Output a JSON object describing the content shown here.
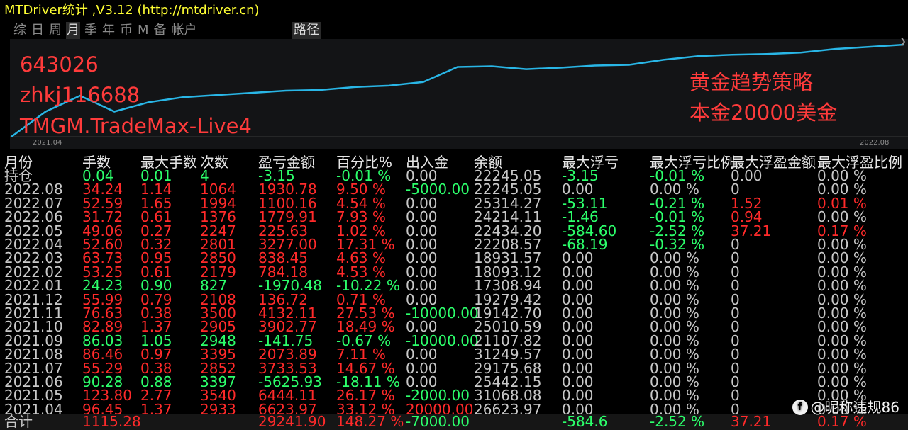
{
  "window": {
    "title": "MTDriver统计 ,V3.12 (http://mtdriver.cn)"
  },
  "tabs": [
    {
      "label": "综"
    },
    {
      "label": "日"
    },
    {
      "label": "周"
    },
    {
      "label": "月",
      "active": true
    },
    {
      "label": "季"
    },
    {
      "label": "年"
    },
    {
      "label": "币"
    },
    {
      "label": "M"
    },
    {
      "label": "备"
    },
    {
      "label": "帐户"
    }
  ],
  "path_button": "路径",
  "chart_data": {
    "type": "line",
    "x_start_label": "2021.04",
    "x_end_label": "2022.08",
    "series": [
      {
        "values": [
          0.0,
          0.35,
          0.57,
          0.35,
          0.48,
          0.55,
          0.58,
          0.61,
          0.64,
          0.65,
          0.69,
          0.71,
          0.76,
          0.97,
          0.98,
          0.94,
          0.96,
          0.99,
          1.0,
          1.07,
          1.12,
          1.14,
          1.15,
          1.17,
          1.22,
          1.25,
          1.28
        ]
      }
    ],
    "line_color": "#29b6e6",
    "annotations_left": [
      "643026",
      "zhkj116688",
      "TMGM.TradeMax-Live4"
    ],
    "annotations_right": [
      "黄金趋势策略",
      "本金20000美金"
    ]
  },
  "table": {
    "headers": [
      "月份",
      "手数",
      "最大手数",
      "次数",
      "盈亏金额",
      "百分比%",
      "出入金",
      "余额",
      "最大浮亏",
      "最大浮亏比例",
      "最大浮盈金额",
      "最大浮盈比例"
    ],
    "rows": [
      {
        "month": "持仓",
        "lots": "0.04",
        "max_lots": "0.01",
        "count": "4",
        "pnl": "-3.15",
        "pct": "-0.01 %",
        "inout": "0.00",
        "balance": "22245.05",
        "max_float_loss": "-3.15",
        "max_float_loss_pct": "-0.01 %",
        "max_float_profit": "0.00",
        "max_float_profit_pct": "0.00 %",
        "sign": "green"
      },
      {
        "month": "2022.08",
        "lots": "34.24",
        "max_lots": "1.14",
        "count": "1064",
        "pnl": "1930.78",
        "pct": "9.50 %",
        "inout": "-5000.00",
        "balance": "22245.05",
        "max_float_loss": "0.00",
        "max_float_loss_pct": "0.00 %",
        "max_float_profit": "0",
        "max_float_profit_pct": "0.00 %",
        "sign": "red"
      },
      {
        "month": "2022.07",
        "lots": "52.59",
        "max_lots": "1.65",
        "count": "1994",
        "pnl": "1100.16",
        "pct": "4.54 %",
        "inout": "0.00",
        "balance": "25314.27",
        "max_float_loss": "-53.11",
        "max_float_loss_pct": "-0.21 %",
        "max_float_profit": "1.52",
        "max_float_profit_pct": "0.01 %",
        "sign": "red"
      },
      {
        "month": "2022.06",
        "lots": "31.72",
        "max_lots": "0.61",
        "count": "1376",
        "pnl": "1779.91",
        "pct": "7.93 %",
        "inout": "0.00",
        "balance": "24214.11",
        "max_float_loss": "-1.46",
        "max_float_loss_pct": "-0.01 %",
        "max_float_profit": "0.94",
        "max_float_profit_pct": "0.00 %",
        "sign": "red"
      },
      {
        "month": "2022.05",
        "lots": "49.06",
        "max_lots": "0.27",
        "count": "2247",
        "pnl": "225.63",
        "pct": "1.02 %",
        "inout": "0.00",
        "balance": "22434.20",
        "max_float_loss": "-584.60",
        "max_float_loss_pct": "-2.52 %",
        "max_float_profit": "37.21",
        "max_float_profit_pct": "0.17 %",
        "sign": "red"
      },
      {
        "month": "2022.04",
        "lots": "52.60",
        "max_lots": "0.32",
        "count": "2801",
        "pnl": "3277.00",
        "pct": "17.31 %",
        "inout": "0.00",
        "balance": "22208.57",
        "max_float_loss": "-68.19",
        "max_float_loss_pct": "-0.32 %",
        "max_float_profit": "0",
        "max_float_profit_pct": "0.00 %",
        "sign": "red"
      },
      {
        "month": "2022.03",
        "lots": "63.73",
        "max_lots": "0.95",
        "count": "2850",
        "pnl": "838.45",
        "pct": "4.63 %",
        "inout": "0.00",
        "balance": "18931.57",
        "max_float_loss": "0.00",
        "max_float_loss_pct": "0.00 %",
        "max_float_profit": "0",
        "max_float_profit_pct": "0.00 %",
        "sign": "red"
      },
      {
        "month": "2022.02",
        "lots": "53.25",
        "max_lots": "0.61",
        "count": "2179",
        "pnl": "784.18",
        "pct": "4.53 %",
        "inout": "0.00",
        "balance": "18093.12",
        "max_float_loss": "0.00",
        "max_float_loss_pct": "0.00 %",
        "max_float_profit": "0",
        "max_float_profit_pct": "0.00 %",
        "sign": "red"
      },
      {
        "month": "2022.01",
        "lots": "24.23",
        "max_lots": "0.90",
        "count": "827",
        "pnl": "-1970.48",
        "pct": "-10.22 %",
        "inout": "0.00",
        "balance": "17308.94",
        "max_float_loss": "0.00",
        "max_float_loss_pct": "0.00 %",
        "max_float_profit": "0",
        "max_float_profit_pct": "0.00 %",
        "sign": "green"
      },
      {
        "month": "2021.12",
        "lots": "55.99",
        "max_lots": "0.79",
        "count": "2108",
        "pnl": "136.72",
        "pct": "0.71 %",
        "inout": "0.00",
        "balance": "19279.42",
        "max_float_loss": "0.00",
        "max_float_loss_pct": "0.00 %",
        "max_float_profit": "0",
        "max_float_profit_pct": "0.00 %",
        "sign": "red"
      },
      {
        "month": "2021.11",
        "lots": "76.63",
        "max_lots": "0.38",
        "count": "3500",
        "pnl": "4132.11",
        "pct": "27.53 %",
        "inout": "-10000.00",
        "balance": "19142.70",
        "max_float_loss": "0.00",
        "max_float_loss_pct": "0.00 %",
        "max_float_profit": "0",
        "max_float_profit_pct": "0.00 %",
        "sign": "red"
      },
      {
        "month": "2021.10",
        "lots": "82.89",
        "max_lots": "1.37",
        "count": "2905",
        "pnl": "3902.77",
        "pct": "18.49 %",
        "inout": "0.00",
        "balance": "25010.59",
        "max_float_loss": "0.00",
        "max_float_loss_pct": "0.00 %",
        "max_float_profit": "0",
        "max_float_profit_pct": "0.00 %",
        "sign": "red"
      },
      {
        "month": "2021.09",
        "lots": "86.03",
        "max_lots": "1.05",
        "count": "2948",
        "pnl": "-141.75",
        "pct": "-0.67 %",
        "inout": "-10000.00",
        "balance": "21107.82",
        "max_float_loss": "0.00",
        "max_float_loss_pct": "0.00 %",
        "max_float_profit": "0",
        "max_float_profit_pct": "0.00 %",
        "sign": "green"
      },
      {
        "month": "2021.08",
        "lots": "86.46",
        "max_lots": "0.97",
        "count": "3395",
        "pnl": "2073.89",
        "pct": "7.11 %",
        "inout": "0.00",
        "balance": "31249.57",
        "max_float_loss": "0.00",
        "max_float_loss_pct": "0.00 %",
        "max_float_profit": "0",
        "max_float_profit_pct": "0.00 %",
        "sign": "red"
      },
      {
        "month": "2021.07",
        "lots": "55.29",
        "max_lots": "0.38",
        "count": "2852",
        "pnl": "3733.53",
        "pct": "14.67 %",
        "inout": "0.00",
        "balance": "29175.68",
        "max_float_loss": "0.00",
        "max_float_loss_pct": "0.00 %",
        "max_float_profit": "0",
        "max_float_profit_pct": "0.00 %",
        "sign": "red"
      },
      {
        "month": "2021.06",
        "lots": "90.28",
        "max_lots": "0.88",
        "count": "3397",
        "pnl": "-5625.93",
        "pct": "-18.11 %",
        "inout": "0.00",
        "balance": "25442.15",
        "max_float_loss": "0.00",
        "max_float_loss_pct": "0.00 %",
        "max_float_profit": "0",
        "max_float_profit_pct": "0.00 %",
        "sign": "green"
      },
      {
        "month": "2021.05",
        "lots": "123.80",
        "max_lots": "2.77",
        "count": "3540",
        "pnl": "6444.11",
        "pct": "26.17 %",
        "inout": "-2000.00",
        "balance": "31068.08",
        "max_float_loss": "0.00",
        "max_float_loss_pct": "0.00 %",
        "max_float_profit": "0",
        "max_float_profit_pct": "0.00 %",
        "sign": "red"
      },
      {
        "month": "2021.04",
        "lots": "96.45",
        "max_lots": "1.37",
        "count": "2933",
        "pnl": "6623.97",
        "pct": "33.12 %",
        "inout": "20000.00",
        "balance": "26623.97",
        "max_float_loss": "0.00",
        "max_float_loss_pct": "0.00 %",
        "max_float_profit": "0",
        "max_float_profit_pct": "0.00 %",
        "sign": "red"
      }
    ],
    "total": {
      "month": "合计",
      "lots": "1115.28",
      "pnl": "29241.90",
      "pct": "148.27 %",
      "inout": "-7000.00",
      "max_float_loss": "-584.6",
      "max_float_loss_pct": "-2.52 %",
      "max_float_profit": "37.21",
      "max_float_profit_pct": "0.17 %"
    }
  },
  "watermark": {
    "text": "@昵称违规86"
  }
}
